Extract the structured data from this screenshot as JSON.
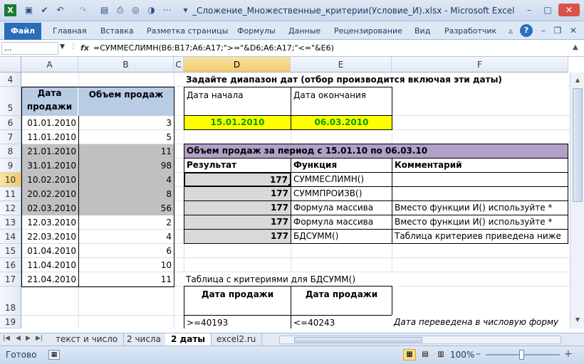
{
  "window": {
    "title": "_Сложение_Множественные_критерии(Условие_И).xlsx  -  Microsoft Excel",
    "minimize": "–",
    "maximize": "□",
    "close": "✕"
  },
  "ribbon": {
    "file_tab": "Файл",
    "tabs": [
      "Главная",
      "Вставка",
      "Разметка страницы",
      "Формулы",
      "Данные",
      "Рецензирование",
      "Вид",
      "Разработчик"
    ]
  },
  "formula_bar": {
    "name_box": "...",
    "fx": "fx",
    "formula": "=СУММЕСЛИМН(B6:B17;A6:A17;\">=\"&D6;A6:A17;\"<=\"&E6)"
  },
  "columns": [
    "A",
    "B",
    "C",
    "D",
    "E",
    "F"
  ],
  "rows": [
    "4",
    "5",
    "6",
    "7",
    "8",
    "9",
    "10",
    "11",
    "12",
    "13",
    "14",
    "15",
    "16",
    "17",
    "18",
    "19"
  ],
  "sheet": {
    "header_date": "Дата продажи",
    "header_volume": "Объем продаж",
    "data": [
      {
        "date": "01.01.2010",
        "value": "3"
      },
      {
        "date": "11.01.2010",
        "value": "5"
      },
      {
        "date": "21.01.2010",
        "value": "11"
      },
      {
        "date": "31.01.2010",
        "value": "98"
      },
      {
        "date": "10.02.2010",
        "value": "4"
      },
      {
        "date": "20.02.2010",
        "value": "8"
      },
      {
        "date": "02.03.2010",
        "value": "56"
      },
      {
        "date": "12.03.2010",
        "value": "2"
      },
      {
        "date": "22.03.2010",
        "value": "4"
      },
      {
        "date": "01.04.2010",
        "value": "6"
      },
      {
        "date": "11.04.2010",
        "value": "10"
      },
      {
        "date": "21.04.2010",
        "value": "11"
      }
    ],
    "d4_title": "Задайте диапазон дат (отбор производится включая эти даты)",
    "label_start": "Дата начала",
    "label_end": "Дата окончания",
    "start_date": "15.01.2010",
    "end_date": "06.03.2010",
    "period_title": "Объем продаж за период с 15.01.10 по 06.03.10",
    "col_result": "Результат",
    "col_function": "Функция",
    "col_comment": "Комментарий",
    "results": [
      {
        "value": "177",
        "function": "СУММЕСЛИМН()",
        "comment": ""
      },
      {
        "value": "177",
        "function": "СУММПРОИЗВ()",
        "comment": ""
      },
      {
        "value": "177",
        "function": "Формула массива",
        "comment": "Вместо функции И() используйте *"
      },
      {
        "value": "177",
        "function": "Формула массива",
        "comment": "Вместо функции И() используйте *"
      },
      {
        "value": "177",
        "function": "БДСУММ()",
        "comment": "Таблица критериев приведена ниже"
      }
    ],
    "criteria_title": "Таблица с критериями для БДСУММ()",
    "crit_header1": "Дата продажи",
    "crit_header2": "Дата продажи",
    "crit_value1": ">=40193",
    "crit_value2": "<=40243",
    "crit_note": "Дата переведена в числовую форму"
  },
  "sheet_tabs": [
    "текст и число",
    "2 числа",
    "2 даты",
    "excel2.ru"
  ],
  "active_sheet": "2 даты",
  "status": {
    "ready": "Готово",
    "zoom": "100%",
    "zoom_minus": "–",
    "zoom_plus": "+"
  },
  "colors": {
    "header_blue": "#b8cce4",
    "gray_fill": "#c0c0c0",
    "yellow_fill": "#ffff00",
    "date_green": "#00a000",
    "purple_fill": "#b1a0c7",
    "light_gray_fill": "#d9d9d9"
  }
}
